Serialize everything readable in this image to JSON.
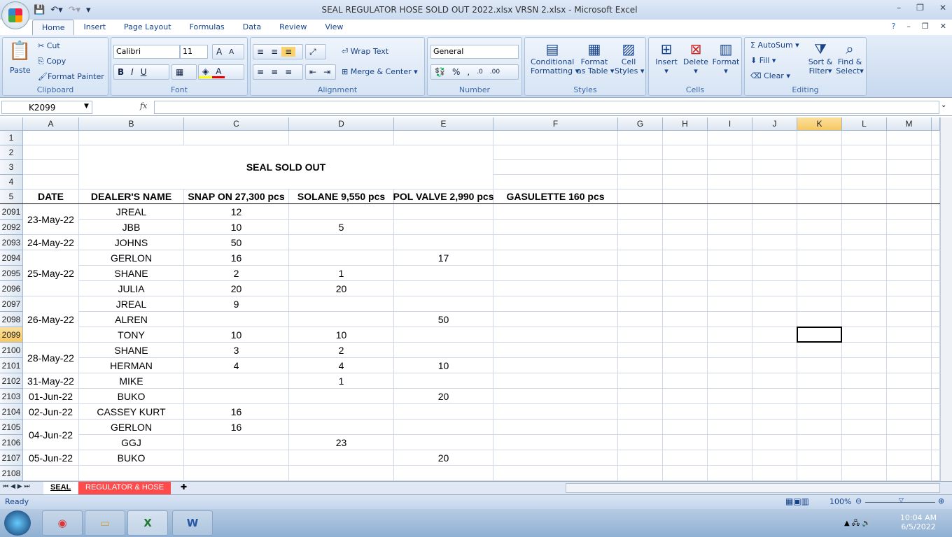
{
  "window": {
    "title": "SEAL REGULATOR HOSE SOLD OUT 2022.xlsx VRSN 2.xlsx - Microsoft Excel"
  },
  "tabs": [
    "Home",
    "Insert",
    "Page Layout",
    "Formulas",
    "Data",
    "Review",
    "View"
  ],
  "ribbon": {
    "clipboard": {
      "label": "Clipboard",
      "paste": "Paste",
      "cut": "Cut",
      "copy": "Copy",
      "format_painter": "Format Painter"
    },
    "font": {
      "label": "Font",
      "name": "Calibri",
      "size": "11"
    },
    "alignment": {
      "label": "Alignment",
      "wrap": "Wrap Text",
      "merge": "Merge & Center"
    },
    "number": {
      "label": "Number",
      "format": "General",
      "percent": "%",
      "comma": ","
    },
    "styles": {
      "label": "Styles",
      "conditional": "Conditional",
      "formatting": "Formatting",
      "format": "Format",
      "as_table": "as Table",
      "cell": "Cell",
      "cell_styles": "Styles"
    },
    "cells": {
      "label": "Cells",
      "insert": "Insert",
      "delete": "Delete",
      "format": "Format"
    },
    "editing": {
      "label": "Editing",
      "autosum": "AutoSum",
      "fill": "Fill",
      "clear": "Clear",
      "sort": "Sort &",
      "filter": "Filter",
      "find": "Find &",
      "select": "Select"
    }
  },
  "formula_bar": {
    "name_box": "K2099",
    "fx": "fx",
    "value": ""
  },
  "columns": [
    "A",
    "B",
    "C",
    "D",
    "E",
    "F",
    "G",
    "H",
    "I",
    "J",
    "K",
    "L",
    "M"
  ],
  "selected_col": "K",
  "selected_row": "2099",
  "sheet": {
    "title": "SEAL SOLD OUT",
    "headers": [
      "DATE",
      "DEALER'S NAME",
      "SNAP ON 27,300 pcs",
      "SOLANE 9,550 pcs",
      "POL VALVE 2,990 pcs",
      "GASULETTE 160 pcs"
    ],
    "rows": [
      {
        "n": "2091",
        "dealer": "JREAL",
        "c": "12",
        "d": "",
        "e": ""
      },
      {
        "n": "2092",
        "dealer": "JBB",
        "c": "10",
        "d": "5",
        "e": ""
      },
      {
        "n": "2093",
        "dealer": "JOHNS",
        "c": "50",
        "d": "",
        "e": ""
      },
      {
        "n": "2094",
        "dealer": "GERLON",
        "c": "16",
        "d": "",
        "e": "17"
      },
      {
        "n": "2095",
        "dealer": "SHANE",
        "c": "2",
        "d": "1",
        "e": ""
      },
      {
        "n": "2096",
        "dealer": "JULIA",
        "c": "20",
        "d": "20",
        "e": ""
      },
      {
        "n": "2097",
        "dealer": "JREAL",
        "c": "9",
        "d": "",
        "e": ""
      },
      {
        "n": "2098",
        "dealer": "ALREN",
        "c": "",
        "d": "",
        "e": "50"
      },
      {
        "n": "2099",
        "dealer": "TONY",
        "c": "10",
        "d": "10",
        "e": ""
      },
      {
        "n": "2100",
        "dealer": "SHANE",
        "c": "3",
        "d": "2",
        "e": ""
      },
      {
        "n": "2101",
        "dealer": "HERMAN",
        "c": "4",
        "d": "4",
        "e": "10"
      },
      {
        "n": "2102",
        "dealer": "MIKE",
        "c": "",
        "d": "1",
        "e": ""
      },
      {
        "n": "2103",
        "dealer": "BUKO",
        "c": "",
        "d": "",
        "e": "20"
      },
      {
        "n": "2104",
        "dealer": "CASSEY KURT",
        "c": "16",
        "d": "",
        "e": ""
      },
      {
        "n": "2105",
        "dealer": "GERLON",
        "c": "16",
        "d": "",
        "e": ""
      },
      {
        "n": "2106",
        "dealer": "GGJ",
        "c": "",
        "d": "23",
        "e": ""
      },
      {
        "n": "2107",
        "dealer": "BUKO",
        "c": "",
        "d": "",
        "e": "20"
      },
      {
        "n": "2108",
        "dealer": "",
        "c": "",
        "d": "",
        "e": ""
      }
    ],
    "dates": [
      {
        "label": "23-May-22",
        "start": 0,
        "span": 2
      },
      {
        "label": "24-May-22",
        "start": 2,
        "span": 1
      },
      {
        "label": "25-May-22",
        "start": 3,
        "span": 3
      },
      {
        "label": "26-May-22",
        "start": 6,
        "span": 3
      },
      {
        "label": "28-May-22",
        "start": 9,
        "span": 2
      },
      {
        "label": "31-May-22",
        "start": 11,
        "span": 1
      },
      {
        "label": "01-Jun-22",
        "start": 12,
        "span": 1
      },
      {
        "label": "02-Jun-22",
        "start": 13,
        "span": 1
      },
      {
        "label": "04-Jun-22",
        "start": 14,
        "span": 2
      },
      {
        "label": "05-Jun-22",
        "start": 16,
        "span": 1
      }
    ]
  },
  "sheet_tabs": [
    "SEAL",
    "REGULATOR & HOSE"
  ],
  "status": {
    "text": "Ready",
    "zoom": "100%"
  },
  "taskbar": {
    "time": "10:04 AM",
    "date": "6/5/2022"
  }
}
